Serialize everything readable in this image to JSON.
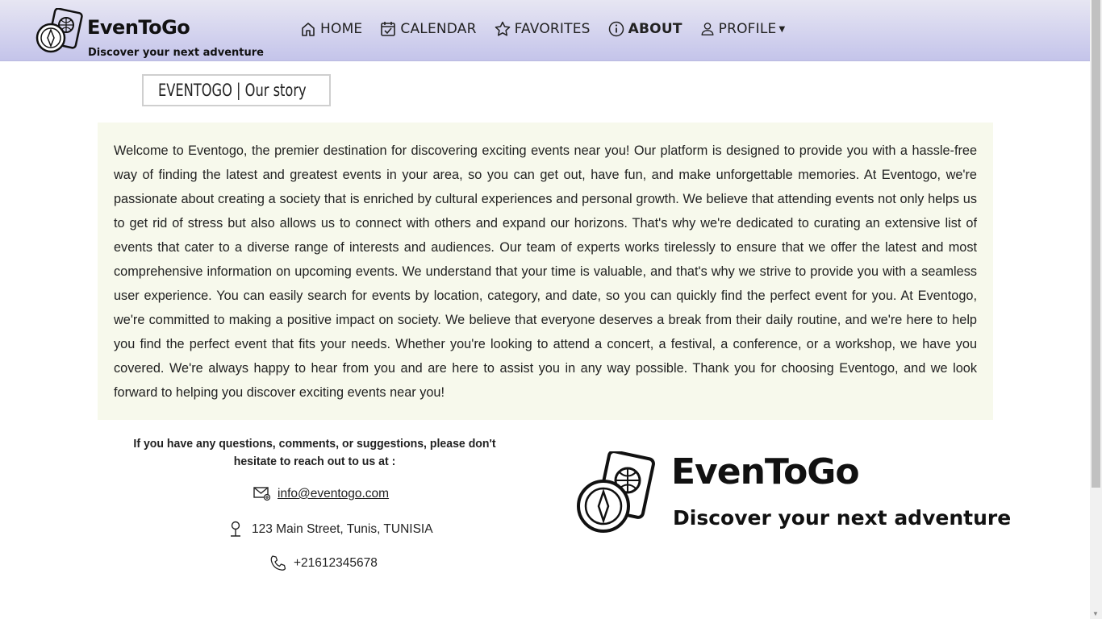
{
  "brand": {
    "name": "EvenToGo",
    "tagline": "Discover your next adventure"
  },
  "nav": {
    "items": [
      {
        "label": "HOME",
        "icon": "home-icon"
      },
      {
        "label": "CALENDAR",
        "icon": "calendar-icon"
      },
      {
        "label": "FAVORITES",
        "icon": "star-icon"
      },
      {
        "label": "ABOUT",
        "icon": "info-icon",
        "active": true
      },
      {
        "label": "PROFILE",
        "icon": "user-icon",
        "dropdown": true
      }
    ]
  },
  "page": {
    "title": "EVENTOGO | Our story",
    "title_icon": "info-icon"
  },
  "story": {
    "text": "Welcome to Eventogo, the premier destination for discovering exciting events near you! Our platform is designed to provide you with a hassle-free way of finding the latest and greatest events in your area, so you can get out, have fun, and make unforgettable memories. At Eventogo, we're passionate about creating a society that is enriched by cultural experiences and personal growth. We believe that attending events not only helps us to get rid of stress but also allows us to connect with others and expand our horizons. That's why we're dedicated to curating an extensive list of events that cater to a diverse range of interests and audiences. Our team of experts works tirelessly to ensure that we offer the latest and most comprehensive information on upcoming events. We understand that your time is valuable, and that's why we strive to provide you with a seamless user experience. You can easily search for events by location, category, and date, so you can quickly find the perfect event for you. At Eventogo, we're committed to making a positive impact on society. We believe that everyone deserves a break from their daily routine, and we're here to help you find the perfect event that fits your needs. Whether you're looking to attend a concert, a festival, a conference, or a workshop, we have you covered. We're always happy to hear from you and are here to assist you in any way possible. Thank you for choosing Eventogo, and we look forward to helping you discover exciting events near you!",
    "background": "#f7f9ec"
  },
  "contact": {
    "intro": "If you have any questions, comments, or suggestions, please don't hesitate to reach out to us at :",
    "email": "info@eventogo.com",
    "address": "123 Main Street, Tunis, TUNISIA",
    "phone": "+21612345678"
  },
  "colors": {
    "header_top": "#e7e6f3",
    "header_bottom": "#c4c4ea"
  }
}
